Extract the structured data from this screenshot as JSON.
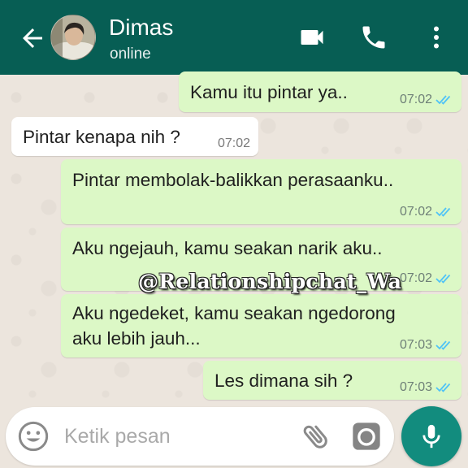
{
  "header": {
    "contact_name": "Dimas",
    "status": "online",
    "icons": [
      "back-arrow-icon",
      "video-call-icon",
      "phone-icon",
      "more-options-icon"
    ]
  },
  "messages": [
    {
      "direction": "outgoing",
      "text": "Kamu itu pintar ya..",
      "time": "07:02",
      "read": true
    },
    {
      "direction": "incoming",
      "text": "Pintar kenapa nih ?",
      "time": "07:02"
    },
    {
      "direction": "outgoing",
      "text": "Pintar membolak-balikkan perasaanku..",
      "time": "07:02",
      "read": true
    },
    {
      "direction": "outgoing",
      "text": "Aku ngejauh, kamu seakan narik aku..",
      "time": "07:02",
      "read": true
    },
    {
      "direction": "outgoing",
      "lines": [
        "Aku ngedeket, kamu seakan ngedorong",
        "aku lebih jauh..."
      ],
      "time": "07:03",
      "read": true
    },
    {
      "direction": "outgoing",
      "text": "Les dimana sih ?",
      "time": "07:03",
      "read": true
    }
  ],
  "watermark": "@Relationshipchat_Wa",
  "composer": {
    "placeholder": "Ketik pesan",
    "icons": [
      "emoji-icon",
      "attach-icon",
      "camera-icon",
      "mic-icon"
    ]
  },
  "colors": {
    "header": "#075e54",
    "outgoing_bubble": "#dcf8c6",
    "incoming_bubble": "#ffffff",
    "read_ticks": "#4fc3f7",
    "mic_button": "#128c7e"
  }
}
